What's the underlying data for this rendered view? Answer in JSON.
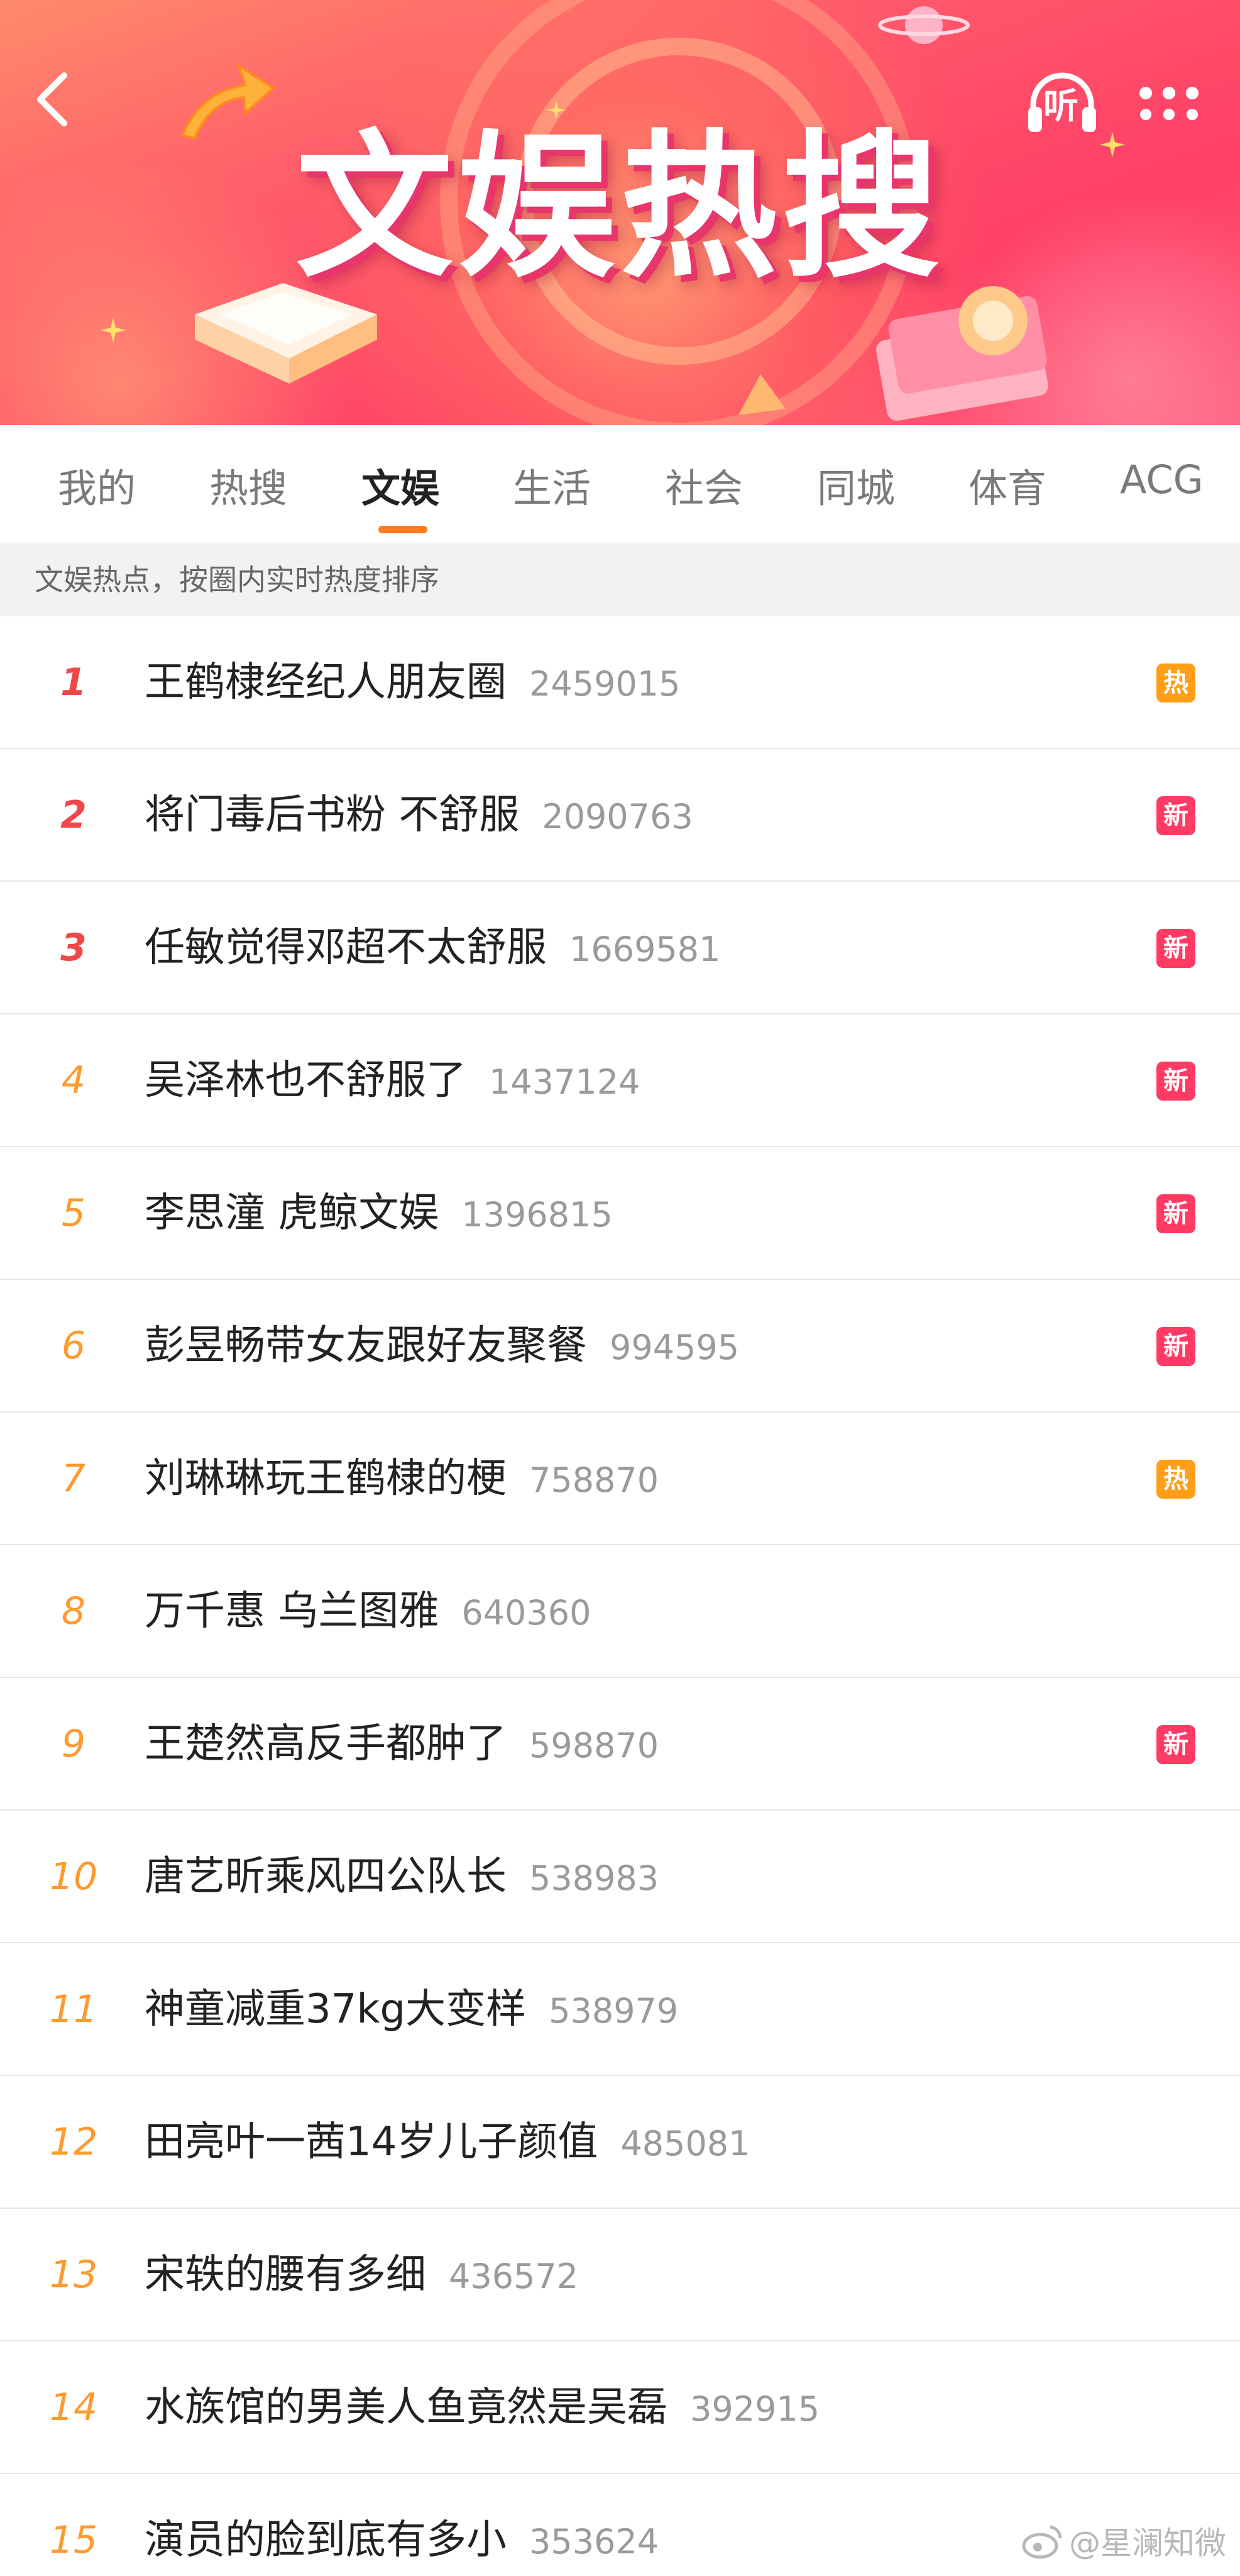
{
  "banner": {
    "title": "文娱热搜",
    "listen_label": "听",
    "colors": {
      "primary": "#ff3f67",
      "accent": "#ff7c1f"
    }
  },
  "tabs": [
    {
      "label": "我的",
      "active": false
    },
    {
      "label": "热搜",
      "active": false
    },
    {
      "label": "文娱",
      "active": true
    },
    {
      "label": "生活",
      "active": false
    },
    {
      "label": "社会",
      "active": false
    },
    {
      "label": "同城",
      "active": false
    },
    {
      "label": "体育",
      "active": false
    },
    {
      "label": "ACG",
      "active": false
    }
  ],
  "subheader": "文娱热点，按圈内实时热度排序",
  "items": [
    {
      "rank": "1",
      "title": "王鹤棣经纪人朋友圈",
      "count": "2459015",
      "badge": "热"
    },
    {
      "rank": "2",
      "title": "将门毒后书粉 不舒服",
      "count": "2090763",
      "badge": "新"
    },
    {
      "rank": "3",
      "title": "任敏觉得邓超不太舒服",
      "count": "1669581",
      "badge": "新"
    },
    {
      "rank": "4",
      "title": "吴泽林也不舒服了",
      "count": "1437124",
      "badge": "新"
    },
    {
      "rank": "5",
      "title": "李思潼 虎鲸文娱",
      "count": "1396815",
      "badge": "新"
    },
    {
      "rank": "6",
      "title": "彭昱畅带女友跟好友聚餐",
      "count": "994595",
      "badge": "新"
    },
    {
      "rank": "7",
      "title": "刘琳琳玩王鹤棣的梗",
      "count": "758870",
      "badge": "热"
    },
    {
      "rank": "8",
      "title": "万千惠 乌兰图雅",
      "count": "640360",
      "badge": ""
    },
    {
      "rank": "9",
      "title": "王楚然高反手都肿了",
      "count": "598870",
      "badge": "新"
    },
    {
      "rank": "10",
      "title": "唐艺昕乘风四公队长",
      "count": "538983",
      "badge": ""
    },
    {
      "rank": "11",
      "title": "神童减重37kg大变样",
      "count": "538979",
      "badge": ""
    },
    {
      "rank": "12",
      "title": "田亮叶一茜14岁儿子颜值",
      "count": "485081",
      "badge": ""
    },
    {
      "rank": "13",
      "title": "宋轶的腰有多细",
      "count": "436572",
      "badge": ""
    },
    {
      "rank": "14",
      "title": "水族馆的男美人鱼竟然是吴磊",
      "count": "392915",
      "badge": ""
    },
    {
      "rank": "15",
      "title": "演员的脸到底有多小",
      "count": "353624",
      "badge": ""
    }
  ],
  "watermark": "@星澜知微"
}
